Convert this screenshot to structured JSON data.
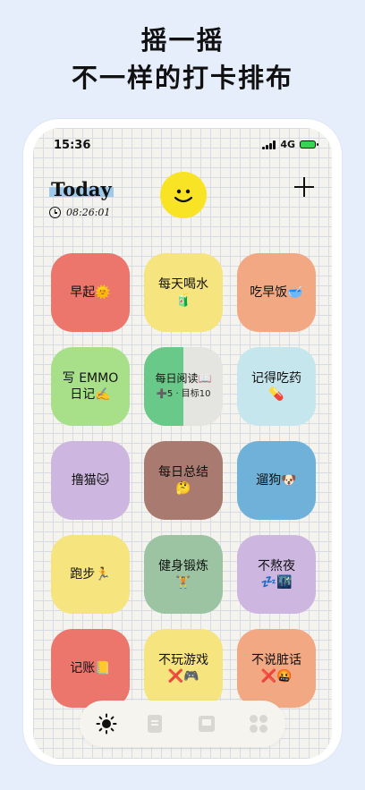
{
  "headline": {
    "line1": "摇一摇",
    "line2": "不一样的打卡排布"
  },
  "status": {
    "time": "15:36",
    "network": "4G"
  },
  "header": {
    "title": "Today",
    "timer": "08:26:01"
  },
  "icons": {
    "clock": "clock-icon",
    "smiley": "smiley-face-icon",
    "add": "plus-icon",
    "signal": "signal-icon",
    "battery": "battery-charging-icon"
  },
  "habits": [
    {
      "label": "早起🌞",
      "color": "#ec766c"
    },
    {
      "label": "每天喝水🧃",
      "color": "#f6e47e"
    },
    {
      "label": "吃早饭🥣",
      "color": "#f2a882"
    },
    {
      "label": "写 EMMO 日记✍️",
      "color": "#a8e08a"
    },
    {
      "label": "每日阅读📖",
      "sub": "➕5 · 目标10",
      "color": "#69c989",
      "progress": 0.5
    },
    {
      "label": "记得吃药💊",
      "color": "#c6e6ee"
    },
    {
      "label": "撸猫🐱",
      "color": "#cdb6df"
    },
    {
      "label": "每日总结🤔",
      "color": "#a97a6f"
    },
    {
      "label": "遛狗🐶",
      "color": "#6fb1d8"
    },
    {
      "label": "跑步🏃",
      "color": "#f6e47e"
    },
    {
      "label": "健身锻炼🏋️",
      "color": "#9cc4a3"
    },
    {
      "label": "不熬夜💤🌃",
      "color": "#cdb6df"
    },
    {
      "label": "记账📒",
      "color": "#ec766c"
    },
    {
      "label": "不玩游戏❌🎮",
      "color": "#f6e47e"
    },
    {
      "label": "不说脏话❌🤬",
      "color": "#f2a882"
    }
  ],
  "tabs": [
    {
      "name": "today",
      "icon": "sun-icon"
    },
    {
      "name": "notes",
      "icon": "document-icon"
    },
    {
      "name": "review",
      "icon": "window-icon"
    },
    {
      "name": "more",
      "icon": "grid-dots-icon"
    }
  ]
}
